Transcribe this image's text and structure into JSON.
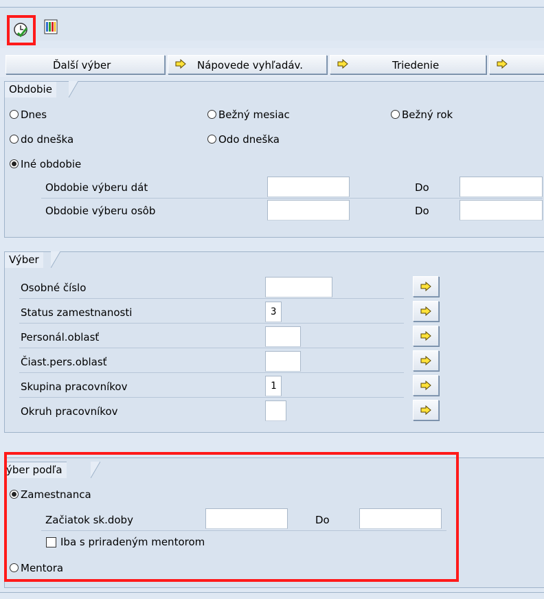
{
  "toolbar": {
    "execute_icon": "clock-execute-icon",
    "layout_icon": "color-columns-icon"
  },
  "button_bar": {
    "further_selection": "Ďalší výber",
    "search_help": "Nápovede vyhľadáv.",
    "sorting": "Triedenie",
    "arrow_icon": "yellow-right-arrow-icon"
  },
  "period": {
    "title": "Obdobie",
    "options": [
      "Dnes",
      "Bežný mesiac",
      "Bežný rok",
      "do dneška",
      "Odo dneška",
      "Iné obdobie"
    ],
    "selected": "Iné obdobie",
    "data_period_label": "Obdobie výberu dát",
    "person_period_label": "Obdobie výberu osôb",
    "to_label": "Do",
    "data_from": "",
    "data_to": "",
    "person_from": "",
    "person_to": ""
  },
  "selection": {
    "title": "Výber",
    "fields": [
      {
        "label": "Osobné číslo",
        "value": ""
      },
      {
        "label": "Status zamestnanosti",
        "value": "3"
      },
      {
        "label": "Personál.oblasť",
        "value": ""
      },
      {
        "label": "Čiast.pers.oblasť",
        "value": ""
      },
      {
        "label": "Skupina pracovníkov",
        "value": "1"
      },
      {
        "label": "Okruh pracovníkov",
        "value": ""
      }
    ]
  },
  "select_by": {
    "title": "ýber podľa",
    "employee_label": "Zamestnanca",
    "start_label": "Začiatok sk.doby",
    "to_label": "Do",
    "start_from": "",
    "start_to": "",
    "mentor_only_label": "Iba s priradeným mentorom",
    "mentor_label": "Mentora",
    "selected": "Zamestnanca"
  },
  "colors": {
    "highlight": "#ff1a1a",
    "background": "#dfe8f3",
    "group": "#d9e3ef"
  }
}
